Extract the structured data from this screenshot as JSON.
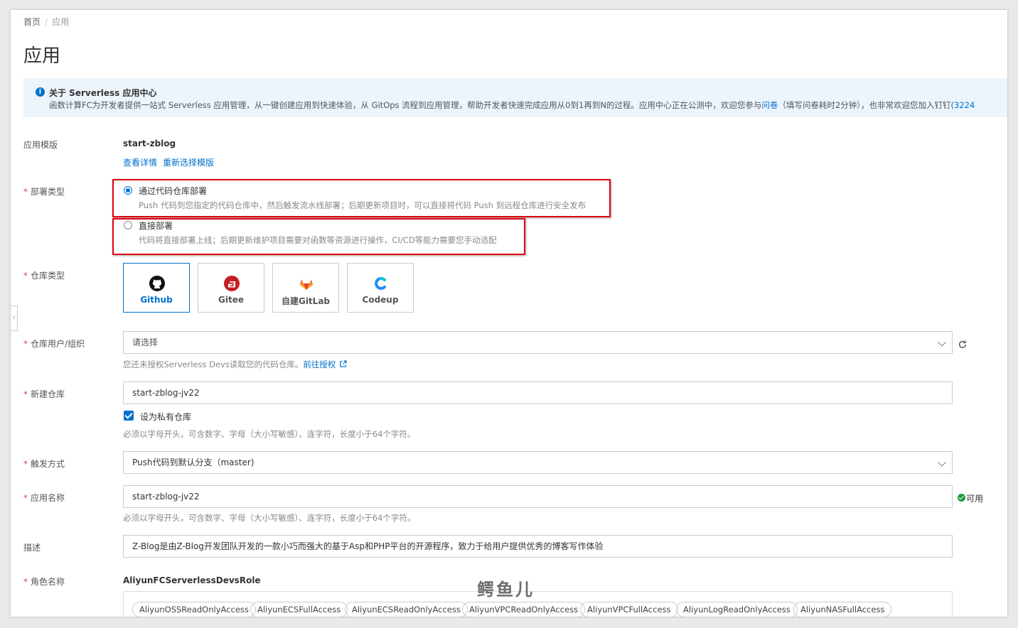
{
  "breadcrumb": {
    "home": "首页",
    "separator": "/",
    "current": "应用"
  },
  "page_title": "应用",
  "notice": {
    "title": "关于 Serverless 应用中心",
    "body_prefix": "函数计算FC为开发者提供一站式 Serverless 应用管理，从一键创建应用到快速体验，从 GitOps 流程到应用管理，帮助开发者快速完成应用从0到1再到N的过程。应用中心正在公测中，欢迎您参与",
    "survey_link": "问卷",
    "body_middle": "（填写问卷耗时2分钟），也非常欢迎您加入钉钉",
    "group_number": "(3224"
  },
  "template": {
    "label": "应用模版",
    "value": "start-zblog",
    "view_details": "查看详情",
    "reselect": "重新选择模版"
  },
  "deploy_type": {
    "label": "部署类型",
    "options": [
      {
        "title": "通过代码仓库部署",
        "desc": "Push 代码到您指定的代码仓库中，然后触发流水线部署；后期更新项目时，可以直接将代码 Push 到远程仓库进行安全发布",
        "selected": true
      },
      {
        "title": "直接部署",
        "desc": "代码将直接部署上线；后期更新维护项目需要对函数等资源进行操作，CI/CD等能力需要您手动适配",
        "selected": false
      }
    ]
  },
  "repo_type": {
    "label": "仓库类型",
    "options": [
      {
        "name": "Github",
        "icon": "github-icon",
        "selected": true
      },
      {
        "name": "Gitee",
        "icon": "gitee-icon",
        "selected": false
      },
      {
        "name": "自建GitLab",
        "icon": "gitlab-icon",
        "selected": false
      },
      {
        "name": "Codeup",
        "icon": "codeup-icon",
        "selected": false
      }
    ]
  },
  "repo_owner": {
    "label": "仓库用户/组织",
    "placeholder": "请选择",
    "hint": "您还未授权Serverless Devs读取您的代码仓库。",
    "auth_link": "前往授权"
  },
  "new_repo": {
    "label": "新建仓库",
    "value": "start-zblog-jv22",
    "private_checkbox": "设为私有仓库",
    "private_checked": true,
    "hint": "必须以字母开头，可含数字、字母（大小写敏感）、连字符，长度小于64个字符。"
  },
  "trigger": {
    "label": "触发方式",
    "value": "Push代码到默认分支（master)"
  },
  "app_name": {
    "label": "应用名称",
    "value": "start-zblog-jv22",
    "status": "可用",
    "hint": "必须以字母开头，可含数字、字母（大小写敏感）、连字符，长度小于64个字符。"
  },
  "description": {
    "label": "描述",
    "value": "Z-Blog是由Z-Blog开发团队开发的一款小巧而强大的基于Asp和PHP平台的开源程序，致力于给用户提供优秀的博客写作体验"
  },
  "role": {
    "label": "角色名称",
    "value": "AliyunFCServerlessDevsRole",
    "policies": [
      "AliyunOSSReadOnlyAccess",
      "AliyunECSFullAccess",
      "AliyunECSReadOnlyAccess",
      "AliyunVPCReadOnlyAccess",
      "AliyunVPCFullAccess",
      "AliyunLogReadOnlyAccess",
      "AliyunNASFullAccess"
    ]
  },
  "watermark": "鳄鱼儿",
  "colors": {
    "accent": "#0070cc",
    "highlight_box": "#e0000f",
    "success": "#1a9a3a",
    "notice_bg": "#ecf4fc"
  }
}
